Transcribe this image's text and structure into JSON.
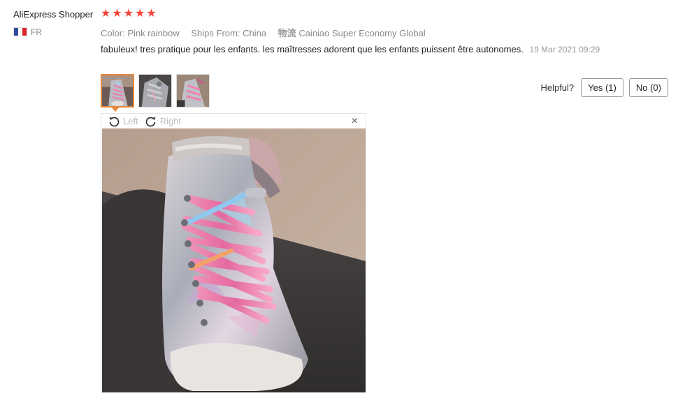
{
  "review": {
    "author": "AliExpress Shopper",
    "country": "FR",
    "flag_colors": [
      "#2f4a9c",
      "#ffffff",
      "#d9262f"
    ],
    "rating": 5,
    "star_color": "#f44336",
    "color_label": "Color:",
    "color_value": "Pink rainbow",
    "ships_label": "Ships From:",
    "ships_value": "China",
    "logistics_label": "物流",
    "logistics_value": "Cainiao Super Economy Global",
    "text": "fabuleux! tres pratique pour les enfants. les maîtresses adorent que les enfants puissent être autonomes.",
    "date": "19 Mar 2021 09:29"
  },
  "photos": {
    "thumbnails": [
      "thumbnail-1",
      "thumbnail-2",
      "thumbnail-3"
    ],
    "active_index": 0,
    "active_border_color": "#e8883a"
  },
  "helpful": {
    "label": "Helpful?",
    "yes_label": "Yes (1)",
    "no_label": "No (0)"
  },
  "viewer": {
    "rotate_left_label": "Left",
    "rotate_right_label": "Right",
    "rotate_left_icon": "rotate-left-icon",
    "rotate_right_icon": "rotate-right-icon",
    "close_icon": "close-icon",
    "close_glyph": "×"
  }
}
